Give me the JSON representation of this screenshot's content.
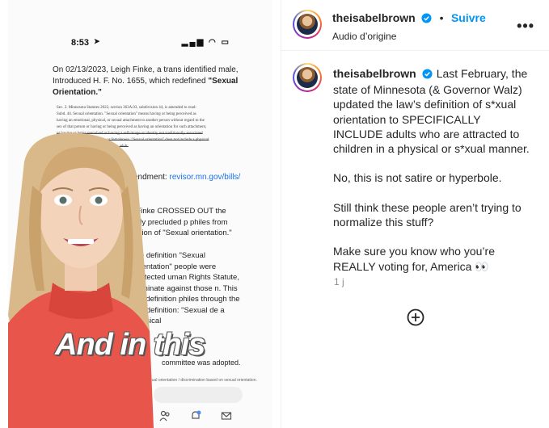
{
  "media": {
    "status_time": "8:53",
    "status_icons": "▂▄▆ ◠ ▭",
    "doc_intro_prefix": "On 02/13/2023, Leigh Finke, a trans identified male,  Introduced H. F. No. 1655, which redefined",
    "doc_intro_bold": "\"Sexual Orientation.\"",
    "statute_line1": "Sec. 2. Minnesota Statutes 2022, section 363A.03, subdivision 44, is amended to read:",
    "statute_line2": "Subd. 44. Sexual orientation. \"Sexual orientation\" means having or being perceived as",
    "statute_line3": "having an emotional, physical, or sexual attachment to another person without regard to the",
    "statute_line4": "sex of that person or having or being perceived as having an orientation for such attachment,",
    "statute_line5": "or having or being perceived as having a self-image or identity not traditionally associated",
    "statute_line6": "with one's biological maleness or femaleness. \"Sexual orientation\" does not include a physical",
    "statute_line7": "or sexual attachment to children by an adult.",
    "amend_prefix": "endment:",
    "amend_link": "revisor.mn.gov/bills/",
    "doc_body": "ent, Finke CROSSED OUT  the pressly precluded p  philes from  definition of \"Sexual orientation.\"",
    "doc_body2": "the definition \"Sexual orientation\" people were protected  uman Rights Statute,  criminate against those  n. This old definition      philes through the   the definition: \"Sexual   de a physical",
    "caption": "And in this",
    "doc_foot": "committee was adopted.",
    "doc_foot2": "sexual orientation / discrimination based on sexual orientation."
  },
  "header": {
    "username": "theisabelbrown",
    "separator": "•",
    "follow_label": "Suivre",
    "audio_label": "Audio d’origine",
    "more_label": "•••"
  },
  "comment": {
    "username": "theisabelbrown",
    "text": "Last February, the state of Minnesota (& Governor Walz) updated the law’s definition of s*xual orientation to SPECIFICALLY INCLUDE adults who are attracted to children in a physical or s*xual manner.\n\nNo, this is not satire or hyperbole.\n\nStill think these people aren’t trying to normalize this stuff?\n\nMake sure you know who you’re REALLY voting for, America 👀",
    "time": "1 j"
  },
  "colors": {
    "accent": "#0095f6",
    "verified": "#0095f6",
    "text": "#262626",
    "muted": "#8e8e8e",
    "link": "#1a73e8"
  },
  "icons": [
    "verified-badge-icon",
    "more-options-icon",
    "add-comment-icon",
    "people-icon",
    "notifications-icon",
    "inbox-icon",
    "location-arrow-icon"
  ]
}
